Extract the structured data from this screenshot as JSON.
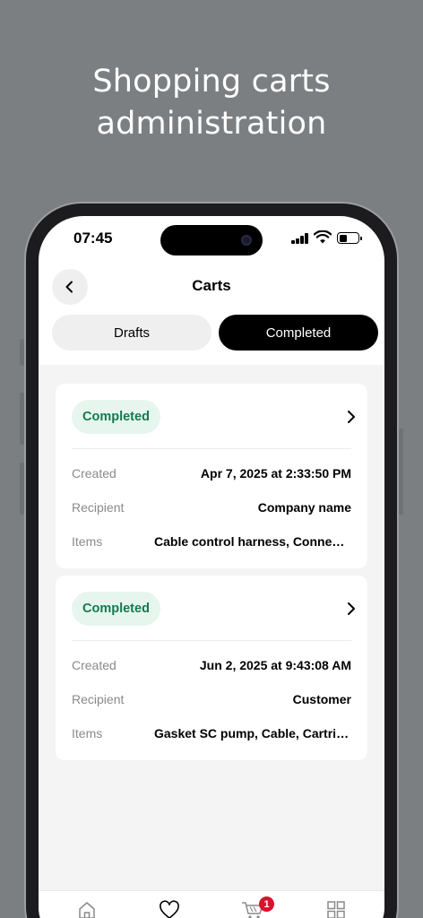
{
  "promo": {
    "headline_line1": "Shopping carts",
    "headline_line2": "administration"
  },
  "status_bar": {
    "time": "07:45"
  },
  "header": {
    "title": "Carts",
    "back_icon": "chevron-left-icon"
  },
  "tabs": [
    {
      "label": "Drafts",
      "active": false
    },
    {
      "label": "Completed",
      "active": true
    }
  ],
  "carts": [
    {
      "status": "Completed",
      "fields": [
        {
          "label": "Created",
          "value": "Apr 7, 2025 at 2:33:50 PM"
        },
        {
          "label": "Recipient",
          "value": "Company name"
        },
        {
          "label": "Items",
          "value": "Cable control harness, Connector"
        }
      ]
    },
    {
      "status": "Completed",
      "fields": [
        {
          "label": "Created",
          "value": "Jun 2, 2025 at 9:43:08 AM"
        },
        {
          "label": "Recipient",
          "value": "Customer"
        },
        {
          "label": "Items",
          "value": "Gasket SC pump, Cable, Cartridge"
        }
      ]
    }
  ],
  "tab_bar": {
    "items": [
      {
        "icon": "home-icon"
      },
      {
        "icon": "heart-icon"
      },
      {
        "icon": "cart-icon",
        "badge": "1"
      },
      {
        "icon": "grid-icon"
      }
    ]
  },
  "colors": {
    "background": "#7b7f82",
    "badge_bg": "#e6f6ee",
    "badge_text": "#137a4e",
    "active_tab": "#000000",
    "cart_badge": "#d8132c"
  }
}
